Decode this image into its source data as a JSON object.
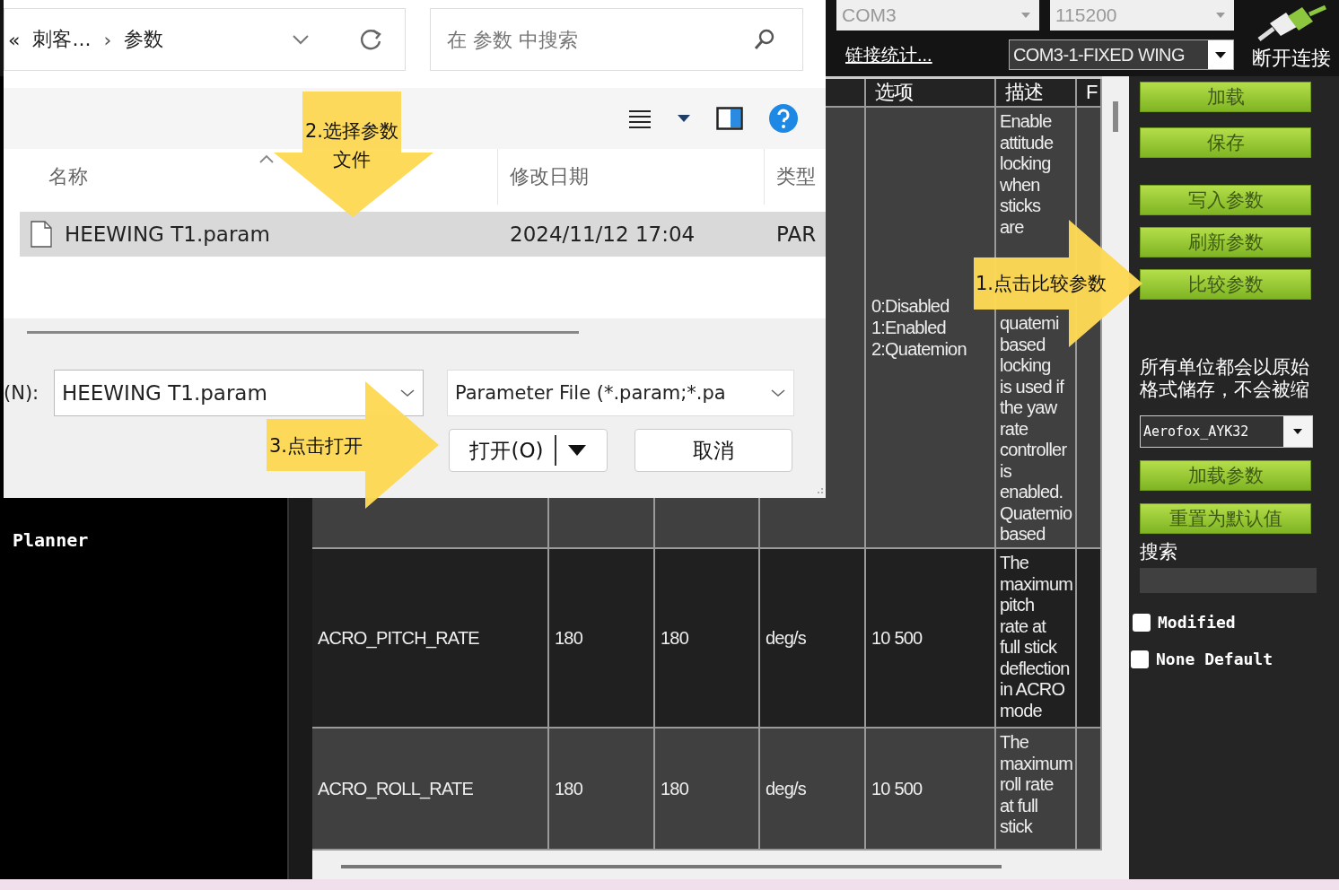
{
  "connection": {
    "port": "COM3",
    "baud": "115200",
    "link_stats": "链接统计...",
    "vehicle": "COM3-1-FIXED WING",
    "disconnect": "断开连接"
  },
  "sidebar": {
    "items": [
      "Planner"
    ]
  },
  "params_table": {
    "visible_headers": [
      "选项",
      "描述",
      "F"
    ],
    "rows": [
      {
        "options": "0:Disabled\n1:Enabled\n2:Quatemion",
        "description": "Enable\nattitude\nlocking\nwhen\nsticks\nare",
        "description_more": "quatemi\nbased\nlocking\nis used if\nthe yaw\nrate\ncontroller\nis\nenabled.\nQuatemio\nbased"
      },
      {
        "name": "ACRO_PITCH_RATE",
        "value": "180",
        "default": "180",
        "units": "deg/s",
        "options": "10 500",
        "description": "The\nmaximum\npitch\nrate at\nfull stick\ndeflection\nin ACRO\nmode"
      },
      {
        "name": "ACRO_ROLL_RATE",
        "value": "180",
        "default": "180",
        "units": "deg/s",
        "options": "10 500",
        "description": "The\nmaximum\nroll rate\nat full\nstick"
      }
    ]
  },
  "actions": {
    "file_buttons": [
      "加载",
      "保存"
    ],
    "param_buttons": [
      "写入参数",
      "刷新参数",
      "比较参数"
    ],
    "note": "所有单位都会以原始格式储存，不会被缩",
    "preset": "Aerofox_AYK32",
    "preset_buttons": [
      "加载参数",
      "重置为默认值"
    ],
    "search_label": "搜索",
    "filters": [
      {
        "label": "Modified",
        "checked": false
      },
      {
        "label": "None Default",
        "checked": false
      }
    ]
  },
  "file_dialog": {
    "back": "«",
    "crumbs": [
      "刺客...",
      "参数"
    ],
    "separator": "›",
    "search": {
      "placeholder": "在 参数 中搜索"
    },
    "columns": [
      "名称",
      "修改日期",
      "类型"
    ],
    "files": [
      {
        "name": "HEEWING T1.param",
        "modified": "2024/11/12 17:04",
        "type": "PAR",
        "selected": true
      }
    ],
    "filename_label": "(N):",
    "filename": "HEEWING T1.param",
    "filter": "Parameter File (*.param;*.pa",
    "buttons": [
      {
        "label": "打开(O)",
        "kind": "split"
      },
      {
        "label": "取消",
        "kind": "plain"
      }
    ]
  },
  "callouts": [
    {
      "text": "2.选择参数文件"
    },
    {
      "text": "1.点击比较参数"
    },
    {
      "text": "3.点击打开"
    }
  ]
}
